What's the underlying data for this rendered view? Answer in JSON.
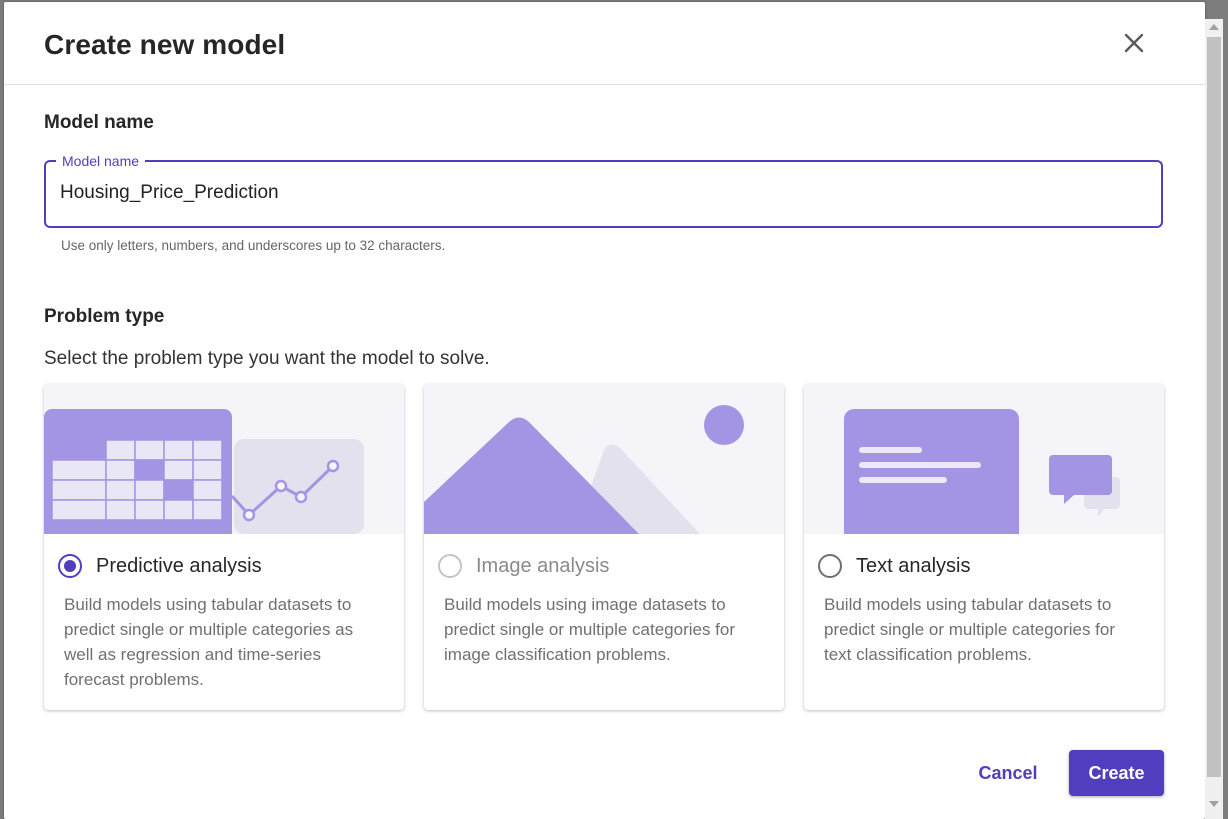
{
  "dialog": {
    "title": "Create new model",
    "close_icon": "close-icon"
  },
  "model_name_section": {
    "heading": "Model name",
    "field_label": "Model name",
    "field_value": "Housing_Price_Prediction",
    "hint": "Use only letters, numbers, and underscores up to 32 characters."
  },
  "problem_type_section": {
    "heading": "Problem type",
    "description": "Select the problem type you want the model to solve.",
    "options": [
      {
        "label": "Predictive analysis",
        "description": "Build models using tabular datasets to predict single or multiple categories as well as regression and time-series forecast problems.",
        "selected": true,
        "disabled": false,
        "icon": "table-chart-illustration"
      },
      {
        "label": "Image analysis",
        "description": "Build models using image datasets to predict single or multiple categories for image classification problems.",
        "selected": false,
        "disabled": true,
        "icon": "mountain-image-illustration"
      },
      {
        "label": "Text analysis",
        "description": "Build models using tabular datasets to predict single or multiple categories for text classification problems.",
        "selected": false,
        "disabled": false,
        "icon": "document-chat-illustration"
      }
    ]
  },
  "footer": {
    "cancel_label": "Cancel",
    "create_label": "Create"
  },
  "colors": {
    "accent": "#4f3fbf",
    "illustration_primary": "#a395e3",
    "illustration_secondary": "#e4e1ee",
    "card_art_bg": "#f5f5f9"
  }
}
